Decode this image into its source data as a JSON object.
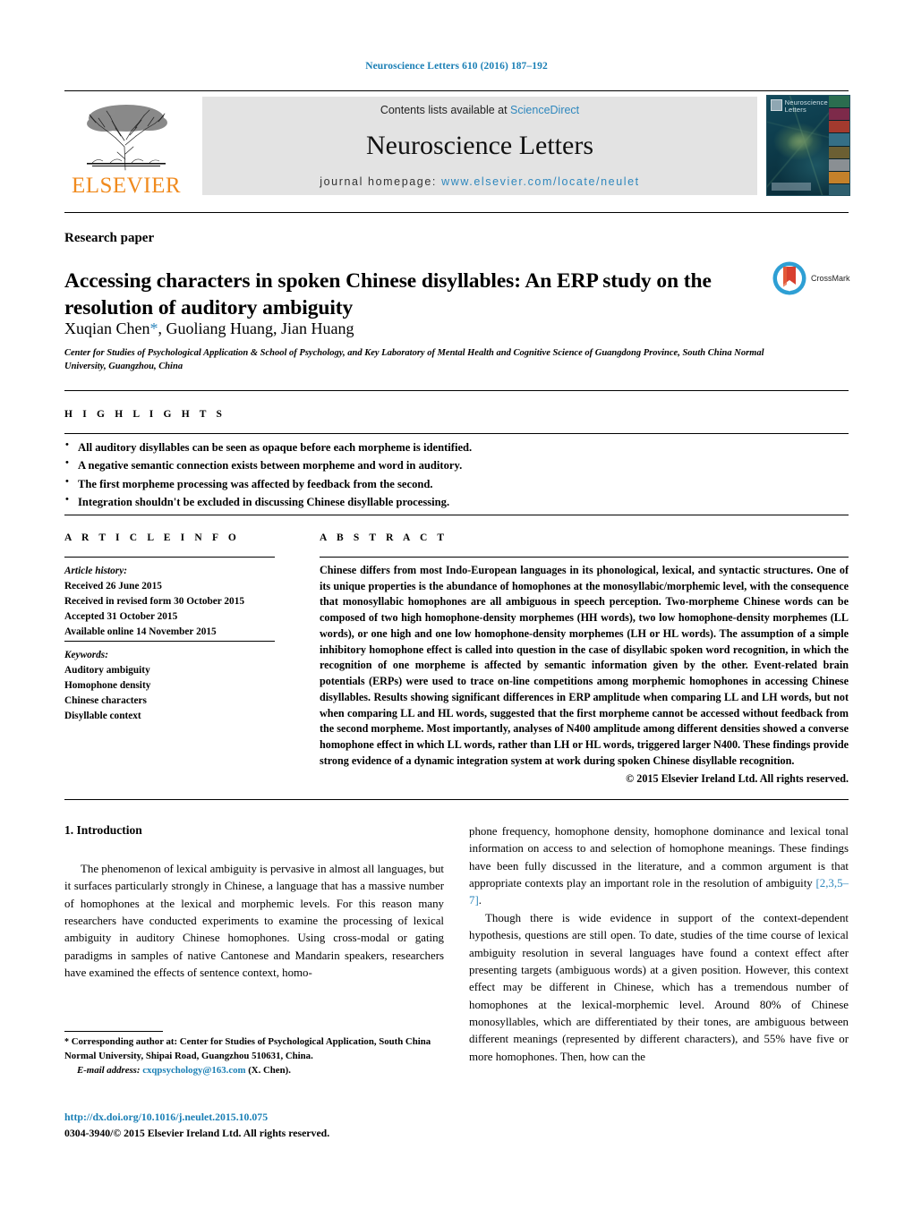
{
  "running_head": "Neuroscience Letters 610 (2016) 187–192",
  "masthead": {
    "publisher_logo_text": "ELSEVIER",
    "contents_prefix": "Contents lists available at ",
    "contents_link": "ScienceDirect",
    "journal_title": "Neuroscience Letters",
    "homepage_prefix": "journal homepage: ",
    "homepage_link": "www.elsevier.com/locate/neulet",
    "cover_title": "Neuroscience Letters",
    "link_color": "#2e87bd",
    "logo_color": "#f08a1d",
    "band_color": "#e3e3e3"
  },
  "article": {
    "doctype": "Research paper",
    "title": "Accessing characters in spoken Chinese disyllables: An ERP study on the resolution of auditory ambiguity",
    "authors": "Xuqian Chen",
    "authors_rest": ", Guoliang Huang, Jian Huang",
    "corresponding_marker": "*",
    "affiliation": "Center for Studies of Psychological Application & School of Psychology, and Key Laboratory of Mental Health and Cognitive Science of Guangdong Province, South China Normal University, Guangzhou, China",
    "crossmark_label": "CrossMark"
  },
  "highlights": {
    "heading": "H I G H L I G H T S",
    "items": [
      "All auditory disyllables can be seen as opaque before each morpheme is identified.",
      "A negative semantic connection exists between morpheme and word in auditory.",
      "The first morpheme processing was affected by feedback from the second.",
      "Integration shouldn't be excluded in discussing Chinese disyllable processing."
    ]
  },
  "article_info": {
    "heading": "A R T I C L E    I N F O",
    "history_label": "Article history:",
    "history": [
      "Received 26 June 2015",
      "Received in revised form 30 October 2015",
      "Accepted 31 October 2015",
      "Available online 14 November 2015"
    ],
    "keywords_label": "Keywords:",
    "keywords": [
      "Auditory ambiguity",
      "Homophone density",
      "Chinese characters",
      "Disyllable context"
    ]
  },
  "abstract": {
    "heading": "A B S T R A C T",
    "text": "Chinese differs from most Indo-European languages in its phonological, lexical, and syntactic structures. One of its unique properties is the abundance of homophones at the monosyllabic/morphemic level, with the consequence that monosyllabic homophones are all ambiguous in speech perception. Two-morpheme Chinese words can be composed of two high homophone-density morphemes (HH words), two low homophone-density morphemes (LL words), or one high and one low homophone-density morphemes (LH or HL words). The assumption of a simple inhibitory homophone effect is called into question in the case of disyllabic spoken word recognition, in which the recognition of one morpheme is affected by semantic information given by the other. Event-related brain potentials (ERPs) were used to trace on-line competitions among morphemic homophones in accessing Chinese disyllables. Results showing significant differences in ERP amplitude when comparing LL and LH words, but not when comparing LL and HL words, suggested that the first morpheme cannot be accessed without feedback from the second morpheme. Most importantly, analyses of N400 amplitude among different densities showed a converse homophone effect in which LL words, rather than LH or HL words, triggered larger N400. These findings provide strong evidence of a dynamic integration system at work during spoken Chinese disyllable recognition.",
    "copyright": "© 2015 Elsevier Ireland Ltd. All rights reserved."
  },
  "body": {
    "section_heading": "1. Introduction",
    "left_paragraph": "The phenomenon of lexical ambiguity is pervasive in almost all languages, but it surfaces particularly strongly in Chinese, a language that has a massive number of homophones at the lexical and morphemic levels. For this reason many researchers have conducted experiments to examine the processing of lexical ambiguity in auditory Chinese homophones. Using cross-modal or gating paradigms in samples of native Cantonese and Mandarin speakers, researchers have examined the effects of sentence context, homo-",
    "right_paragraph_1a": "phone frequency, homophone density, homophone dominance and lexical tonal information on access to and selection of homophone meanings. These findings have been fully discussed in the literature, and a common argument is that appropriate contexts play an important role in the resolution of ambiguity ",
    "right_citation": "[2,3,5–7]",
    "right_paragraph_1b": ".",
    "right_paragraph_2": "Though there is wide evidence in support of the context-dependent hypothesis, questions are still open. To date, studies of the time course of lexical ambiguity resolution in several languages have found a context effect after presenting targets (ambiguous words) at a given position. However, this context effect may be different in Chinese, which has a tremendous number of homophones at the lexical-morphemic level. Around 80% of Chinese monosyllables, which are differentiated by their tones, are ambiguous between different meanings (represented by different characters), and 55% have five or more homophones. Then, how can the"
  },
  "footnotes": {
    "corresponding_marker": "*",
    "corresponding_text": " Corresponding author at: Center for Studies of Psychological Application, South China Normal University, Shipai Road, Guangzhou 510631, China.",
    "email_label": "E-mail address:",
    "email": "cxqpsychology@163.com",
    "email_suffix": " (X. Chen).",
    "doi": "http://dx.doi.org/10.1016/j.neulet.2015.10.075",
    "issn_line": "0304-3940/© 2015 Elsevier Ireland Ltd. All rights reserved."
  }
}
